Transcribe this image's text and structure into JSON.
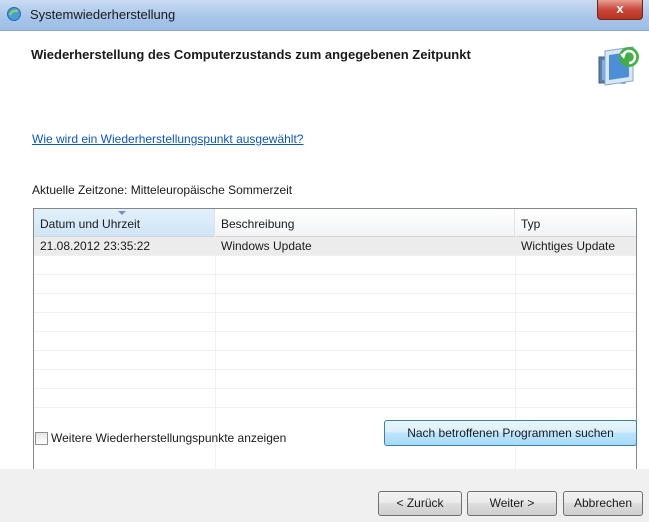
{
  "window": {
    "title": "Systemwiederherstellung",
    "close_label": "x"
  },
  "header": {
    "title": "Wiederherstellung des Computerzustands zum angegebenen Zeitpunkt"
  },
  "content": {
    "help_link": "Wie wird ein Wiederherstellungspunkt ausgewählt?",
    "timezone_label": "Aktuelle Zeitzone: Mitteleuropäische Sommerzeit",
    "table": {
      "columns": [
        "Datum und Uhrzeit",
        "Beschreibung",
        "Typ"
      ],
      "rows": [
        [
          "21.08.2012 23:35:22",
          "Windows Update",
          "Wichtiges Update"
        ]
      ]
    },
    "show_more_label": "Weitere Wiederherstellungspunkte anzeigen",
    "search_button": "Nach betroffenen Programmen suchen"
  },
  "footer": {
    "back_button": "< Zurück",
    "next_button": "Weiter >",
    "cancel_button": "Abbrechen"
  },
  "colors": {
    "link": "#0b56c4",
    "close_button": "#c9463a"
  }
}
